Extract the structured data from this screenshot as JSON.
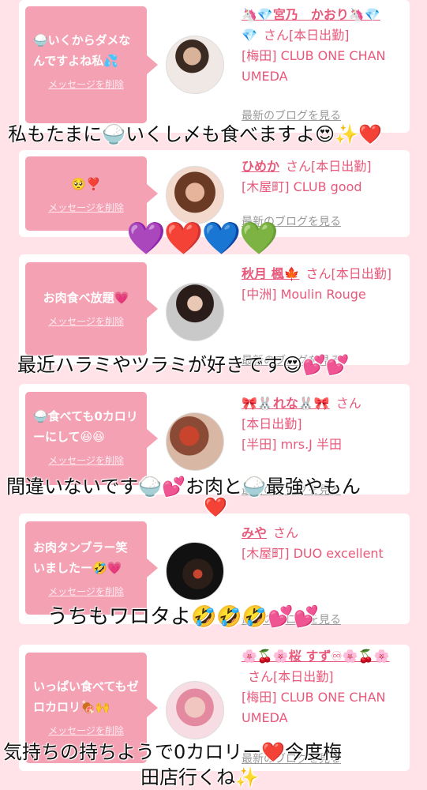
{
  "delete_label": "メッセージを削除",
  "blog_label": "最新のブログを見る",
  "san": "さん",
  "cards": [
    {
      "message": "🍚いくからダメなんですよね私💦",
      "name": "🦄💎宮乃　かおり🦄💎",
      "status": "[本日出勤]",
      "shop": "[梅田] CLUB ONE CHAN UMEDA"
    },
    {
      "message": "🥺❣️",
      "name": "ひめか",
      "status": "[本日出勤]",
      "shop": "[木屋町] CLUB good"
    },
    {
      "message": "お肉食べ放題💗",
      "name": "秋月 楓🍁",
      "status": "[本日出勤]",
      "shop": "[中洲] Moulin Rouge"
    },
    {
      "message": "🍚食べても0カロリーにして😆😆",
      "name": "🎀🐰れな🐰🎀",
      "status": "[本日出勤]",
      "shop": "[半田] mrs.J 半田"
    },
    {
      "message": "お肉タンブラー笑いましたー🤣💗",
      "name": "みや",
      "status": "",
      "shop": "[木屋町] DUO excellent"
    },
    {
      "message": "いっぱい食べてもゼロカロリ🍖🙌",
      "name": "🌸🍒🌸桜 すず♾🌸🍒🌸",
      "status": "[本日出勤]",
      "shop": "[梅田] CLUB ONE CHAN UMEDA"
    }
  ],
  "overlays": {
    "t1": "私もたまに🍚いくし〆も食べますよ😍✨❤️",
    "hearts": "💜❤️💙💚",
    "t2": "最近ハラミやツラミが好きです😍💕💕",
    "t3": "間違いないです🍚💕お肉と🍚最強やもん",
    "t3b": "❤️",
    "t4": "うちもワロタよ🤣🤣🤣💕💕",
    "t5a": "気持ちの持ちようで0カロリー❤️今度梅",
    "t5b": "田店行くね✨"
  }
}
